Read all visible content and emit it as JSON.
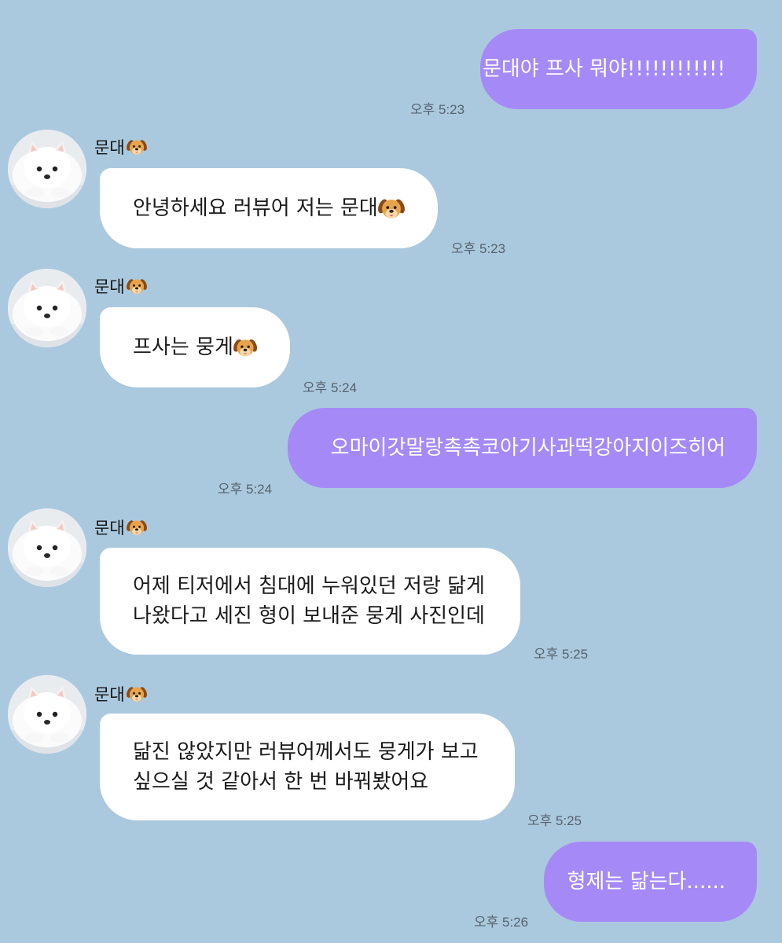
{
  "contact": {
    "name": "문대",
    "name_icon": "dog-face-icon"
  },
  "messages": [
    {
      "dir": "out",
      "text": "문대야 프사 뭐야!!!!!!!!!!!!",
      "time": "오후 5:23"
    },
    {
      "dir": "in",
      "lines": [
        "안녕하세요 러뷰어 저는 문대"
      ],
      "trailing_icon": "dog-face-icon",
      "time": "오후 5:23"
    },
    {
      "dir": "in",
      "lines": [
        "프사는 뭉게"
      ],
      "trailing_icon": "dog-face-icon",
      "time": "오후 5:24"
    },
    {
      "dir": "out",
      "text": "오마이갓말랑촉촉코아기사과떡강아지이즈히어",
      "time": "오후 5:24"
    },
    {
      "dir": "in",
      "lines": [
        "어제 티저에서 침대에 누워있던 저랑 닮게",
        "나왔다고 세진 형이 보내준 뭉게 사진인데"
      ],
      "time": "오후 5:25"
    },
    {
      "dir": "in",
      "lines": [
        "닮진 않았지만 러뷰어께서도 뭉게가 보고",
        "싶으실 것 같아서 한 번 바꿔봤어요"
      ],
      "time": "오후 5:25"
    },
    {
      "dir": "out",
      "text": "형제는 닮는다......",
      "time": "오후 5:26"
    }
  ]
}
